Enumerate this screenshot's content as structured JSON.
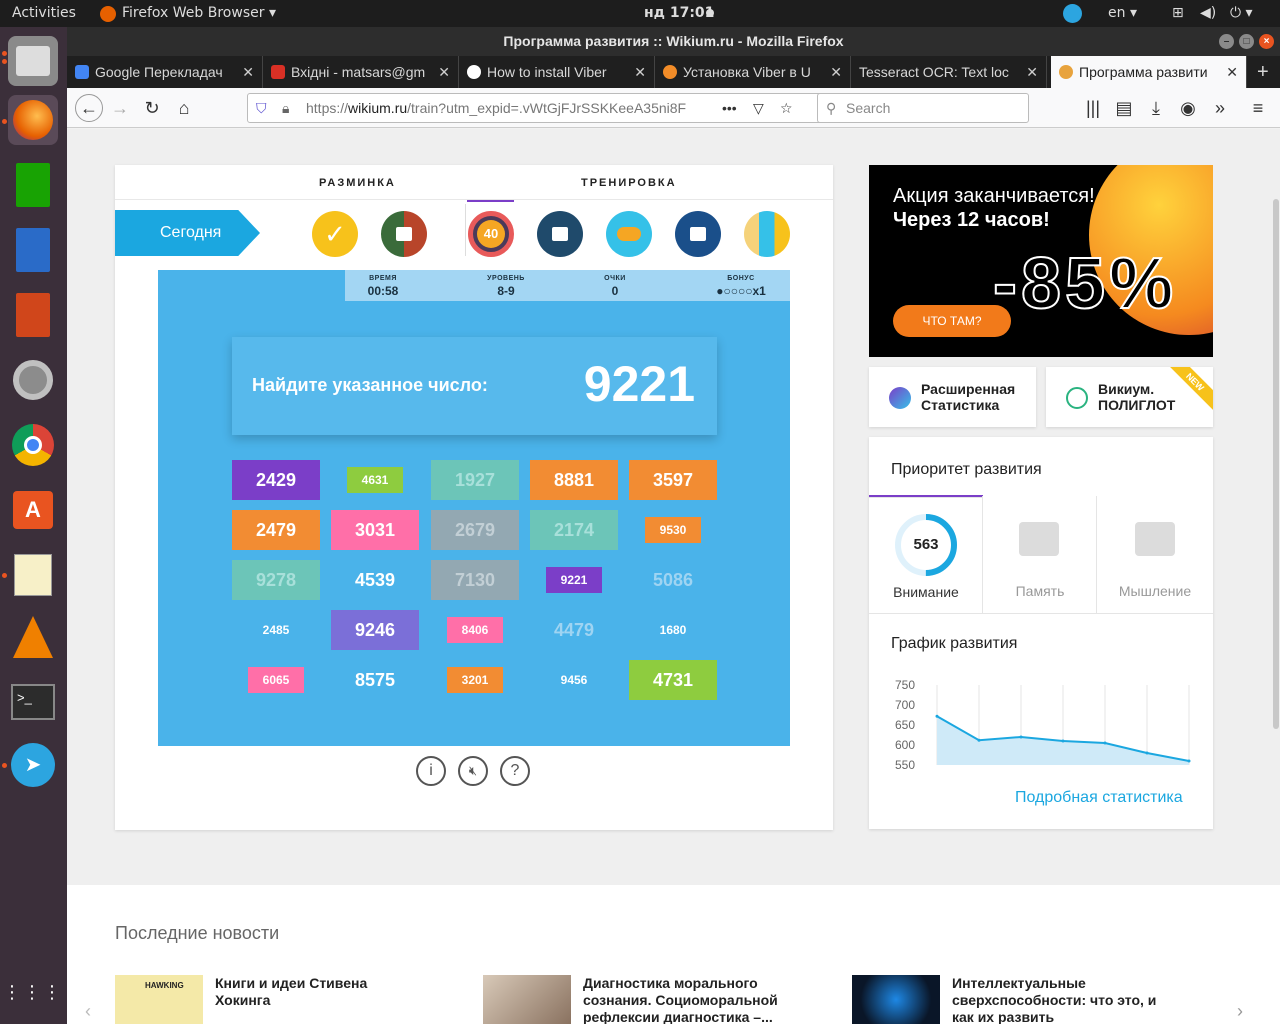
{
  "system_bar": {
    "activities": "Activities",
    "app_name": "Firefox Web Browser",
    "clock": "нд 17:01",
    "language": "en"
  },
  "window": {
    "title": "Программа развития :: Wikium.ru - Mozilla Firefox"
  },
  "tabs": [
    {
      "label": "Google Перекладач",
      "color": "#4285f4"
    },
    {
      "label": "Вхідні - matsars@gm",
      "color": "#d93025"
    },
    {
      "label": "How to install Viber",
      "color": "#333333"
    },
    {
      "label": "Установка Viber в U",
      "color": "#f28c28"
    },
    {
      "label": "Tesseract OCR: Text loc",
      "color": "#1f1f1f"
    },
    {
      "label": "Программа развити",
      "color": "#e8a33d"
    }
  ],
  "nav": {
    "url_prefix": "https://",
    "url_host": "wikium.ru",
    "url_path": "/train?utm_expid=.vWtGjFJrSSKKeeA35ni8F",
    "search_placeholder": "Search"
  },
  "training": {
    "tab_warmup": "РАЗМИНКА",
    "tab_training": "ТРЕНИРОВКА",
    "today_label": "Сегодня",
    "circle_40": "40",
    "stats": [
      {
        "label": "ВРЕМЯ",
        "value": "00:58"
      },
      {
        "label": "УРОВЕНЬ",
        "value": "8-9"
      },
      {
        "label": "ОЧКИ",
        "value": "0"
      },
      {
        "label": "БОНУС",
        "value": "●○○○○x1"
      }
    ],
    "find_label": "Найдите указанное число:",
    "target": "9221",
    "grid": [
      {
        "n": "2429",
        "bg": "#7b3ec8",
        "fs": 18,
        "w": 88,
        "h": 40
      },
      {
        "n": "4631",
        "bg": "#8ecc3f",
        "fs": 12,
        "w": 56,
        "h": 26
      },
      {
        "n": "1927",
        "bg": "#6cc5b8",
        "fs": 18,
        "w": 88,
        "h": 40,
        "fc": "#a8e0da"
      },
      {
        "n": "8881",
        "bg": "#f28c33",
        "fs": 18,
        "w": 88,
        "h": 40
      },
      {
        "n": "3597",
        "bg": "#f28c33",
        "fs": 18,
        "w": 88,
        "h": 40
      },
      {
        "n": "2479",
        "bg": "#f28c33",
        "fs": 18,
        "w": 88,
        "h": 40
      },
      {
        "n": "3031",
        "bg": "#ff6fa8",
        "fs": 18,
        "w": 88,
        "h": 40
      },
      {
        "n": "2679",
        "bg": "#93a8b2",
        "fs": 18,
        "w": 88,
        "h": 40,
        "fc": "#c2cfd5"
      },
      {
        "n": "2174",
        "bg": "#6cc5b8",
        "fs": 18,
        "w": 88,
        "h": 40,
        "fc": "#a8e0da"
      },
      {
        "n": "9530",
        "bg": "#f28c33",
        "fs": 12,
        "w": 56,
        "h": 26
      },
      {
        "n": "9278",
        "bg": "#6cc5b8",
        "fs": 18,
        "w": 88,
        "h": 40,
        "fc": "#a8e0da"
      },
      {
        "n": "4539",
        "bg": "transparent",
        "fs": 18,
        "w": 88,
        "h": 40
      },
      {
        "n": "7130",
        "bg": "#93a8b2",
        "fs": 18,
        "w": 88,
        "h": 40,
        "fc": "#c2cfd5"
      },
      {
        "n": "9221",
        "bg": "#7b3ec8",
        "fs": 12,
        "w": 56,
        "h": 26
      },
      {
        "n": "5086",
        "bg": "transparent",
        "fs": 18,
        "w": 88,
        "h": 40,
        "fc": "#9fd4f2"
      },
      {
        "n": "2485",
        "bg": "transparent",
        "fs": 12,
        "w": 56,
        "h": 26
      },
      {
        "n": "9246",
        "bg": "#7b6fd8",
        "fs": 18,
        "w": 88,
        "h": 40
      },
      {
        "n": "8406",
        "bg": "#ff6fa8",
        "fs": 12,
        "w": 56,
        "h": 26
      },
      {
        "n": "4479",
        "bg": "transparent",
        "fs": 18,
        "w": 88,
        "h": 40,
        "fc": "#9fd4f2"
      },
      {
        "n": "1680",
        "bg": "transparent",
        "fs": 12,
        "w": 56,
        "h": 26
      },
      {
        "n": "6065",
        "bg": "#ff6fa8",
        "fs": 12,
        "w": 56,
        "h": 26
      },
      {
        "n": "8575",
        "bg": "transparent",
        "fs": 18,
        "w": 88,
        "h": 40
      },
      {
        "n": "3201",
        "bg": "#f28c33",
        "fs": 12,
        "w": 56,
        "h": 26
      },
      {
        "n": "9456",
        "bg": "transparent",
        "fs": 12,
        "w": 56,
        "h": 26
      },
      {
        "n": "4731",
        "bg": "#8ecc3f",
        "fs": 18,
        "w": 88,
        "h": 40
      }
    ]
  },
  "promo": {
    "line1": "Акция заканчивается!",
    "line2": "Через 12 часов!",
    "discount": "-85%",
    "button": "ЧТО ТАМ?"
  },
  "extra": {
    "stats_label": "Расширенная Статистика",
    "poly_line1": "Викиум.",
    "poly_line2": "ПОЛИГЛОТ",
    "new_badge": "NEW"
  },
  "priority": {
    "title": "Приоритет развития",
    "attention_value": "563",
    "attention_progress": 0.5,
    "items": [
      "Внимание",
      "Память",
      "Мышление"
    ]
  },
  "progress_chart": {
    "title": "График развития",
    "link": "Подробная статистика"
  },
  "chart_data": {
    "type": "area",
    "title": "График развития",
    "y_ticks": [
      "750",
      "700",
      "650",
      "600",
      "550"
    ],
    "ylim": [
      550,
      750
    ],
    "values": [
      672,
      612,
      620,
      610,
      605,
      580,
      560
    ]
  },
  "news": {
    "heading": "Последние новости",
    "thumb_label": "HAWKING",
    "items": [
      {
        "line1": "Книги и идеи Стивена",
        "line2": "Хокинга"
      },
      {
        "line1": "Диагностика морального",
        "line2": "сознания. Социоморальной",
        "line3": "рефлексии диагностика –..."
      },
      {
        "line1": "Интеллектуальные",
        "line2": "сверхспособности: что это, и",
        "line3": "как их развить"
      }
    ]
  }
}
